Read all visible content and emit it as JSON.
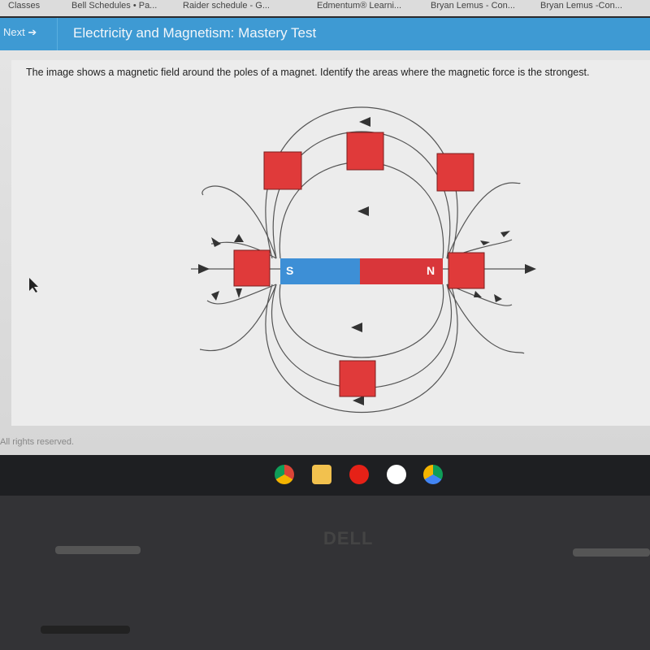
{
  "bookmarks": [
    "Classes",
    "Bell Schedules • Pa...",
    "Raider schedule - G...",
    "Edmentum® Learni...",
    "Bryan Lemus - Con...",
    "Bryan Lemus -Con..."
  ],
  "header": {
    "next_label": "Next",
    "title": "Electricity and Magnetism: Mastery Test",
    "color": "#3e9ad3"
  },
  "question": "The image shows a magnetic field around the poles of a magnet. Identify the areas where the magnetic force is the strongest.",
  "diagram": {
    "south_label": "S",
    "north_label": "N",
    "south_color": "#3d8fd6",
    "north_color": "#d9363a",
    "target_color": "#e03a3a"
  },
  "footer": "All rights reserved.",
  "taskbar": [
    "chrome-icon",
    "files-icon",
    "youtube-icon",
    "gmail-icon",
    "drive-icon"
  ],
  "brand": "DELL"
}
